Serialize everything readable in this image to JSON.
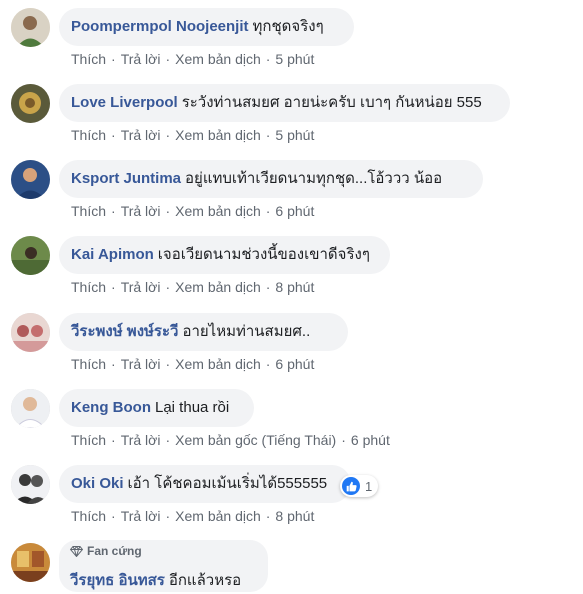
{
  "comments": [
    {
      "author": "Poompermpol Noojeenjit",
      "text": "ทุกชุดจริงๆ",
      "actions": [
        "Thích",
        "Trả lời",
        "Xem bản dịch"
      ],
      "time": "5 phút"
    },
    {
      "author": "Love Liverpool",
      "text": "ระวังท่านสมยศ อายน่ะครับ เบาๆ กันหน่อย 555",
      "actions": [
        "Thích",
        "Trả lời",
        "Xem bản dịch"
      ],
      "time": "5 phút"
    },
    {
      "author": "Ksport Juntima",
      "text": "อยู่แทบเท้าเวียดนามทุกชุด...โอ้ววว น้ออ",
      "actions": [
        "Thích",
        "Trả lời",
        "Xem bản dịch"
      ],
      "time": "6 phút"
    },
    {
      "author": "Kai Apimon",
      "text": "เจอเวียดนามช่วงนี้ของเขาดีจริงๆ",
      "actions": [
        "Thích",
        "Trả lời",
        "Xem bản dịch"
      ],
      "time": "8 phút"
    },
    {
      "author": "วีระพงษ์ พงษ์ระวี",
      "text": "อายไหมท่านสมยศ..",
      "actions": [
        "Thích",
        "Trả lời",
        "Xem bản dịch"
      ],
      "time": "6 phút"
    },
    {
      "author": "Keng Boon",
      "text": "Lại thua rồi",
      "actions": [
        "Thích",
        "Trả lời",
        "Xem bản gốc (Tiếng Thái)"
      ],
      "time": "6 phút"
    },
    {
      "author": "Oki Oki",
      "text": "เอ้า โค้ชคอมเม้นเริ่มได้555555",
      "actions": [
        "Thích",
        "Trả lời",
        "Xem bản dịch"
      ],
      "time": "8 phút",
      "reaction_count": "1"
    },
    {
      "author": "วีรยุทธ อินทสร",
      "text": "อีกแล้วหรอ",
      "badge": "Fan cứng"
    }
  ],
  "colors": {
    "author": "#385898",
    "bubble": "#f2f3f5",
    "meta": "#606770",
    "like": "#2078f4"
  },
  "icons": {
    "badge": "diamond-icon",
    "reaction": "thumbs-up-icon"
  }
}
